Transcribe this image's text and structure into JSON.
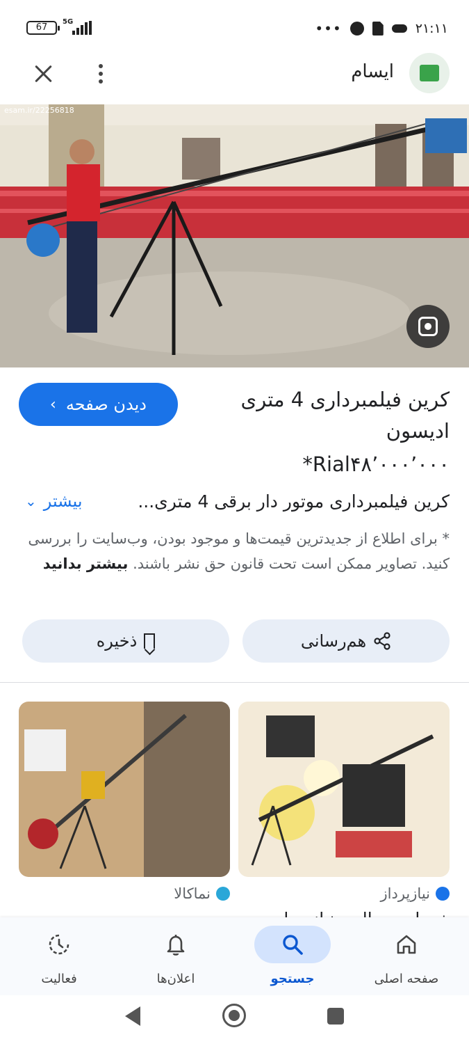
{
  "status_bar": {
    "battery": "67",
    "network": "5G",
    "time": "۲۱:۱۱"
  },
  "header": {
    "site_name": "ایسام"
  },
  "image": {
    "watermark": "esam.ir/22256818"
  },
  "result": {
    "title": "کرین فیلمبرداری 4 متری ادیسون",
    "view_button": "دیدن صفحه",
    "price": "*Rial۴۸٬۰۰۰٬۰۰۰",
    "description": "کرین فیلمبرداری موتور دار برقی 4 متری...",
    "more_label": "بیشتر",
    "note": "* برای اطلاع از جدیدترین قیمت‌ها و موجود بودن، وب‌سایت را بررسی کنید. تصاویر ممکن است تحت قانون حق نشر باشند.",
    "learn_more": "بیشتر بدانید"
  },
  "actions": {
    "share": "هم‌رسانی",
    "save": "ذخیره"
  },
  "related": [
    {
      "source": "نیازپرداز",
      "title": "خدمات مجالس نیازپردا..."
    },
    {
      "source": "نماکالا",
      "title": ""
    }
  ],
  "bottom_nav": [
    {
      "label": "صفحه اصلی",
      "icon": "home-icon"
    },
    {
      "label": "جستجو",
      "icon": "search-icon",
      "active": true
    },
    {
      "label": "اعلان‌ها",
      "icon": "bell-icon"
    },
    {
      "label": "فعالیت",
      "icon": "activity-icon"
    }
  ],
  "colors": {
    "accent": "#1a73e8",
    "action_bg": "#e8eef7",
    "nav_active_bg": "#d3e3fd"
  }
}
